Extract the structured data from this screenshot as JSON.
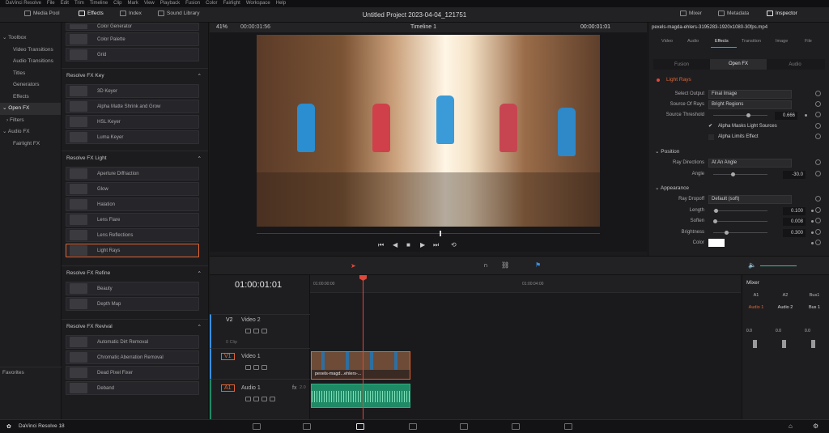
{
  "menu": [
    "DaVinci Resolve",
    "File",
    "Edit",
    "Trim",
    "Timeline",
    "Clip",
    "Mark",
    "View",
    "Playback",
    "Fusion",
    "Color",
    "Fairlight",
    "Workspace",
    "Help"
  ],
  "toolbar": {
    "media_pool": "Media Pool",
    "effects": "Effects",
    "index": "Index",
    "sound_library": "Sound Library",
    "project_title": "Untitled Project 2023-04-04_121751",
    "mixer": "Mixer",
    "metadata": "Metadata",
    "inspector": "Inspector"
  },
  "sidebar": {
    "items": [
      "Toolbox",
      "Video Transitions",
      "Audio Transitions",
      "Titles",
      "Generators",
      "Effects",
      "Open FX",
      "Filters",
      "Audio FX",
      "Fairlight FX"
    ],
    "favorites": "Favorites"
  },
  "fxlist": {
    "top_items": [
      "Color Generator",
      "Color Palette",
      "Grid"
    ],
    "key_section": "Resolve FX Key",
    "key_items": [
      "3D Keyer",
      "Alpha Matte Shrink and Grow",
      "HSL Keyer",
      "Luma Keyer"
    ],
    "light_section": "Resolve FX Light",
    "light_items": [
      "Aperture Diffraction",
      "Glow",
      "Halation",
      "Lens Flare",
      "Lens Reflections",
      "Light Rays"
    ],
    "refine_section": "Resolve FX Refine",
    "refine_items": [
      "Beauty",
      "Depth Map"
    ],
    "revival_section": "Resolve FX Revival",
    "revival_items": [
      "Automatic Dirt Removal",
      "Chromatic Aberration Removal",
      "Dead Pixel Fixer",
      "Deband"
    ]
  },
  "viewer": {
    "zoom": "41%",
    "source_tc": "00:00:01:56",
    "timeline_name": "Timeline 1",
    "record_tc": "00:00:01:01"
  },
  "inspector": {
    "clip_name": "pexels-magda-ehlers-3195283-1920x1080-30fps.mp4",
    "tabs": [
      "Video",
      "Audio",
      "Effects",
      "Transition",
      "Image",
      "File"
    ],
    "subtabs": [
      "Fusion",
      "Open FX",
      "Audio"
    ],
    "effect_name": "Light Rays",
    "select_output_label": "Select Output",
    "select_output": "Final Image",
    "source_of_rays_label": "Source Of Rays",
    "source_of_rays": "Bright Regions",
    "source_threshold_label": "Source Threshold",
    "source_threshold": "0.666",
    "alpha_masks": "Alpha Masks Light Sources",
    "alpha_limits": "Alpha Limits Effect",
    "position_group": "Position",
    "ray_directions_label": "Ray Directions",
    "ray_directions": "At An Angle",
    "angle_label": "Angle",
    "angle": "-30.0",
    "appearance_group": "Appearance",
    "ray_dropoff_label": "Ray Dropoff",
    "ray_dropoff": "Default (soft)",
    "length_label": "Length",
    "length": "0.100",
    "soften_label": "Soften",
    "soften": "0.008",
    "brightness_label": "Brightness",
    "brightness": "0.300",
    "color_label": "Color"
  },
  "timeline": {
    "timecode": "01:00:01:01",
    "ruler_ticks": [
      "01:00:00:00",
      "01:00:04:00"
    ],
    "v2_id": "V2",
    "v2_name": "Video 2",
    "v2_count": "0 Clip",
    "v1_id": "V1",
    "v1_name": "Video 1",
    "a1_id": "A1",
    "a1_name": "Audio 1",
    "a1_fx": "fx",
    "a1_level": "2.0",
    "clip_name": "pexels-magd...ehlers-..."
  },
  "mixer": {
    "title": "Mixer",
    "channels": [
      "A1",
      "A2",
      "Bus1"
    ],
    "channel_names": [
      "Audio 1",
      "Audio 2",
      "Bus 1"
    ],
    "levels": [
      "0.0",
      "0.0",
      "0.0"
    ]
  },
  "bottom": {
    "app_name": "DaVinci Resolve 18"
  }
}
